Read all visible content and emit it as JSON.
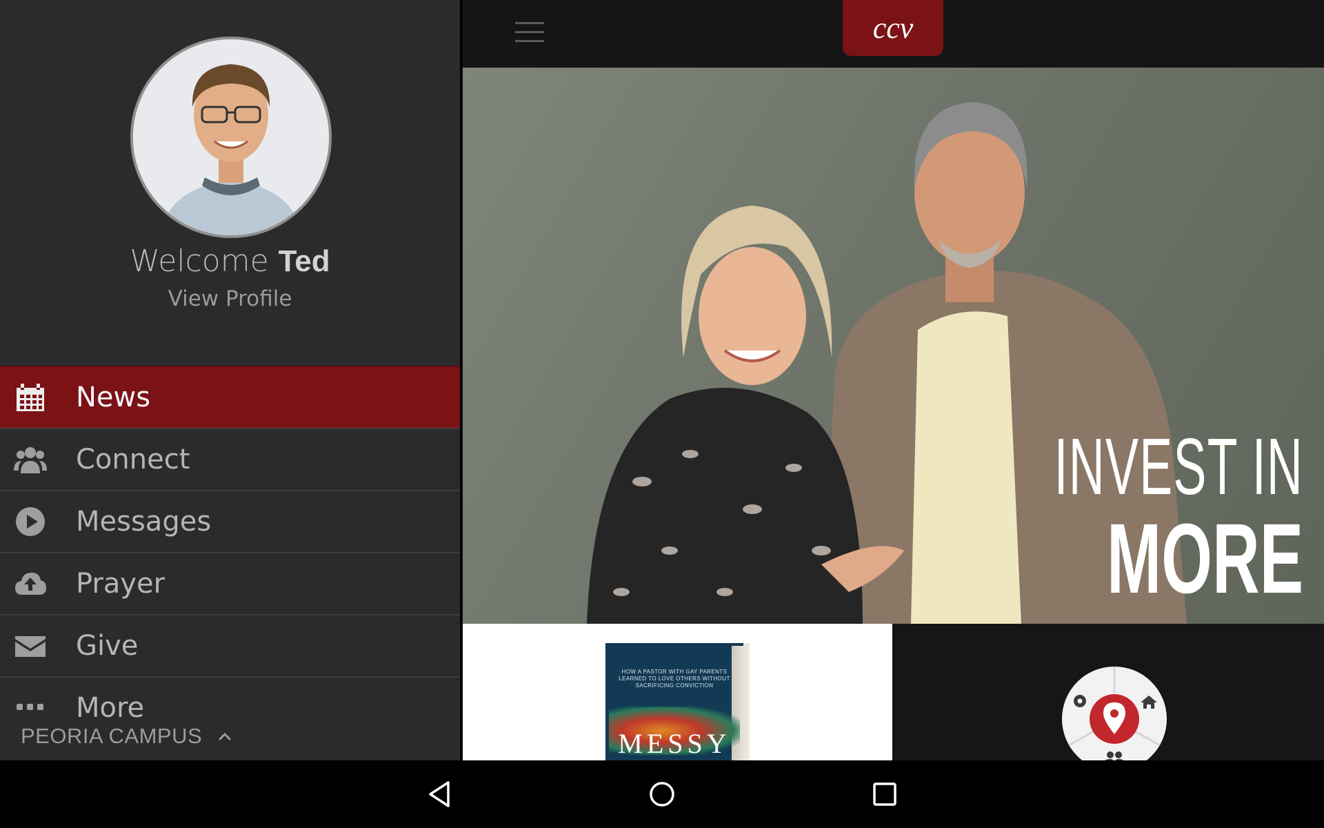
{
  "drawer": {
    "welcome_prefix": "Welcome",
    "user_name": "Ted",
    "view_profile": "View Profile",
    "items": [
      {
        "label": "News",
        "icon": "calendar-icon",
        "active": true
      },
      {
        "label": "Connect",
        "icon": "users-icon",
        "active": false
      },
      {
        "label": "Messages",
        "icon": "play-circle-icon",
        "active": false
      },
      {
        "label": "Prayer",
        "icon": "cloud-upload-icon",
        "active": false
      },
      {
        "label": "Give",
        "icon": "envelope-icon",
        "active": false
      },
      {
        "label": "More",
        "icon": "ellipsis-icon",
        "active": false
      }
    ],
    "campus": "PEORIA CAMPUS"
  },
  "header": {
    "logo_text": "ccv"
  },
  "hero": {
    "line1": "INVEST IN",
    "line2": "MORE"
  },
  "book_card": {
    "subtitle": "HOW A PASTOR WITH GAY PARENTS LEARNED TO LOVE OTHERS WITHOUT SACRIFICING CONVICTION",
    "title": "MESSY"
  },
  "colors": {
    "accent": "#7b1216",
    "drawer_bg": "#2b2b2b",
    "main_bg": "#141414"
  }
}
